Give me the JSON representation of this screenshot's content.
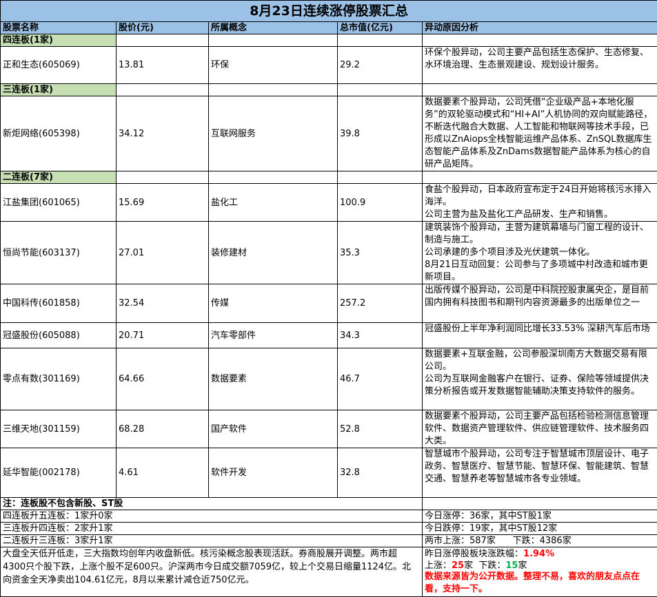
{
  "title": "8月23日连续涨停股票汇总",
  "headers": [
    "股票名称",
    "股价(元)",
    "所属概念",
    "总市值(亿元)",
    "异动原因分析"
  ],
  "groups": [
    {
      "label": "四连板(1家)",
      "rows": [
        {
          "name": "正和生态(605069)",
          "price": "13.81",
          "concept": "环保",
          "cap": "29.2",
          "reason": [
            "环保个股异动，公司主要产品包括生态保护、生态修复、水环境治理、生态景观建设、规划设计服务。"
          ]
        }
      ]
    },
    {
      "label": "三连板(1家)",
      "rows": [
        {
          "name": "新炬网络(605398)",
          "price": "34.12",
          "concept": "互联网服务",
          "cap": "39.8",
          "reason": [
            "数据要素个股异动，公司凭借“企业级产品+本地化服务”的双轮驱动模式和“HI+AI”人机协同的双向赋能路径，不断迭代融合大数据、人工智能和物联网等技术手段，已形成以ZnAiops全栈智能运维产品体系、ZnSQL数据库生态智能产品体系及ZnDams数据智能产品体系为核心的自研产品矩阵。"
          ]
        }
      ]
    },
    {
      "label": "二连板(7家)",
      "rows": [
        {
          "name": "江盐集团(601065)",
          "price": "15.69",
          "concept": "盐化工",
          "cap": "100.9",
          "reason": [
            "食盐个股异动，日本政府宣布定于24日开始将核污水排入海洋。",
            "公司主营为盐及盐化工产品研发、生产和销售。"
          ]
        },
        {
          "name": "恒尚节能(603137)",
          "price": "27.01",
          "concept": "装修建材",
          "cap": "35.3",
          "reason": [
            "建筑装饰个股异动，主营为建筑幕墙与门窗工程的设计、制造与施工。",
            "公司承建的多个项目涉及光伏建筑一体化。",
            "8月21日互动回复：公司参与了多项城中村改造和城市更新项目。"
          ]
        },
        {
          "name": "中国科传(601858)",
          "price": "32.54",
          "concept": "传媒",
          "cap": "257.2",
          "reason": [
            "出版传媒个股异动，公司是中科院控股隶属央企，是目前国内拥有科技图书和期刊内容资源最多的出版单位之一"
          ]
        },
        {
          "name": "冠盛股份(605088)",
          "price": "20.71",
          "concept": "汽车零部件",
          "cap": "34.3",
          "reason": [
            "冠盛股份上半年净利润同比增长33.53% 深耕汽车后市场"
          ]
        },
        {
          "name": "零点有数(301169)",
          "price": "64.66",
          "concept": "数据要素",
          "cap": "46.7",
          "reason": [
            "数据要素+互联金融，公司参股深圳南方大数据交易有限公司。",
            "公司为互联网金融客户在银行、证券、保险等领域提供决策分析报告或开发数据智能辅助决策支持软件的服务。"
          ]
        },
        {
          "name": "三维天地(301159)",
          "price": "68.28",
          "concept": "国产软件",
          "cap": "52.8",
          "reason": [
            "数据要素个股异动，公司主要产品包括检验检测信息管理软件、数据资产管理软件、供应链管理软件、技术服务四大类。"
          ]
        },
        {
          "name": "延华智能(002178)",
          "price": "4.61",
          "concept": "软件开发",
          "cap": "32.8",
          "reason": [
            "智慧城市个股异动，公司专注于智慧城市顶层设计、电子政务、智慧医疗、智慧节能、智慧环保、智能建筑、智慧交通、智慧养老等智慧城市各专业领域。"
          ]
        }
      ]
    }
  ],
  "note": "注：连板股不包含新股、ST股",
  "promotions": [
    "四连板升五连板：1家升0家",
    "三连板升四连板：2家升1家",
    "二连板升三连板：3家升1家"
  ],
  "stats": [
    "今日涨停：36家，其中ST股1家",
    "今日跌停：19家，其中ST股12家",
    "两市上涨：587家      下跌：4386家"
  ],
  "market_summary": "大盘全天低开低走，三大指数均创年内收盘新低。核污染概念股表现活跃。券商股展开调整。两市超4300只个股下跌，上涨个股不足600只。沪深两市今日成交额7059亿，较上个交易日缩量1124亿。北向资金全天净卖出104.61亿元，8月以来累计减仓近750亿元。",
  "yesterday": {
    "label": "昨日涨停股板块涨跌幅：",
    "pct": "1.94%",
    "up_label": "上涨：",
    "up": "25",
    "up_unit": "家  下跌：",
    "down": "15",
    "down_unit": "家"
  },
  "footnote": "数据来源皆为公开数据。整理不易，喜欢的朋友点点在看，支持一下。",
  "colors": {
    "header_bg": "#9bc2e6",
    "group_bg": "#c6e0b4",
    "highlight_red": "#ff0000",
    "highlight_green": "#00b050"
  }
}
